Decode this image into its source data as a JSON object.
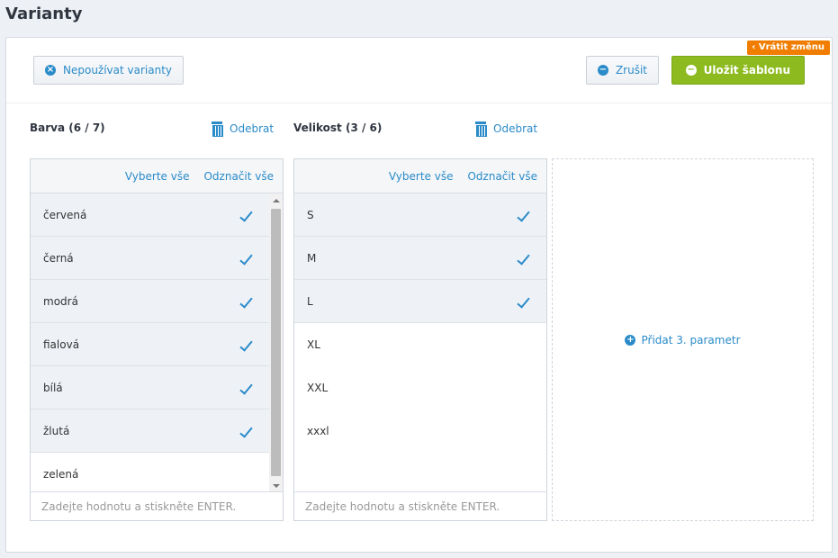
{
  "page": {
    "title": "Varianty"
  },
  "toolbar": {
    "revert_label": "‹ Vrátit změnu",
    "no_variants_label": "Nepoužívat varianty",
    "cancel_label": "Zrušit",
    "save_label": "Uložit šablonu"
  },
  "params": [
    {
      "title": "Barva (6 / 7)",
      "remove_label": "Odebrat",
      "select_all": "Vyberte vše",
      "deselect_all": "Odznačit vše",
      "placeholder": "Zadejte hodnotu a stiskněte ENTER.",
      "items": [
        {
          "label": "červená",
          "selected": true
        },
        {
          "label": "černá",
          "selected": true
        },
        {
          "label": "modrá",
          "selected": true
        },
        {
          "label": "fialová",
          "selected": true
        },
        {
          "label": "bílá",
          "selected": true
        },
        {
          "label": "žlutá",
          "selected": true
        },
        {
          "label": "zelená",
          "selected": false
        }
      ]
    },
    {
      "title": "Velikost (3 / 6)",
      "remove_label": "Odebrat",
      "select_all": "Vyberte vše",
      "deselect_all": "Odznačit vše",
      "placeholder": "Zadejte hodnotu a stiskněte ENTER.",
      "items": [
        {
          "label": "S",
          "selected": true
        },
        {
          "label": "M",
          "selected": true
        },
        {
          "label": "L",
          "selected": true
        },
        {
          "label": "XL",
          "selected": false
        },
        {
          "label": "XXL",
          "selected": false
        },
        {
          "label": "xxxl",
          "selected": false
        }
      ]
    }
  ],
  "add_param_label": "Přidat 3. parametr",
  "colors": {
    "accent": "#2a8bc9",
    "save": "#8dbb1f",
    "revert": "#f07d00"
  }
}
